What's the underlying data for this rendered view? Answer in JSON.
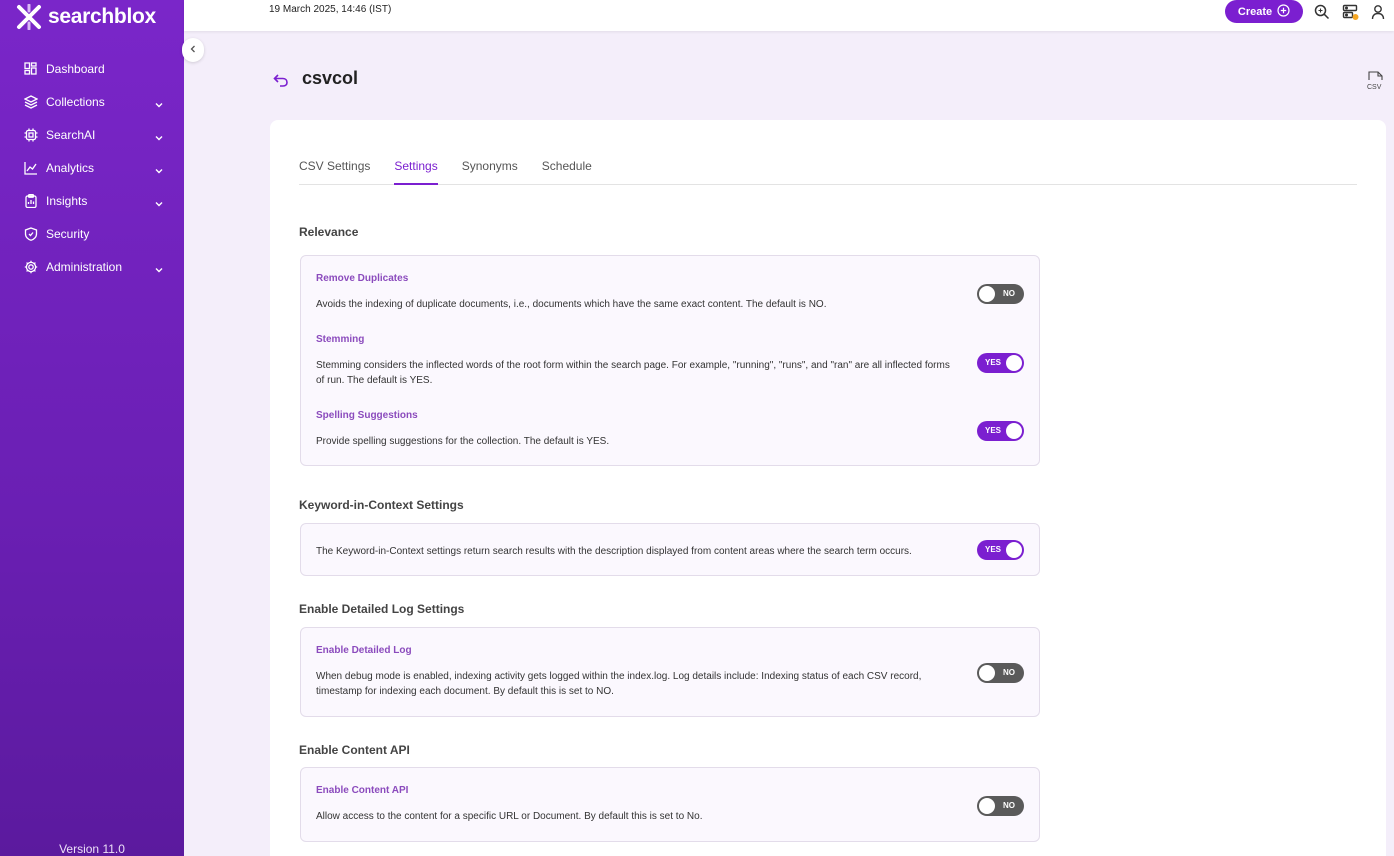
{
  "app": {
    "name": "searchblox",
    "version": "Version 11.0"
  },
  "sidebar": {
    "items": [
      {
        "label": "Dashboard",
        "icon": "dashboard-icon",
        "has_chevron": false
      },
      {
        "label": "Collections",
        "icon": "layers-icon",
        "has_chevron": true
      },
      {
        "label": "SearchAI",
        "icon": "chip-icon",
        "has_chevron": true
      },
      {
        "label": "Analytics",
        "icon": "chart-icon",
        "has_chevron": true
      },
      {
        "label": "Insights",
        "icon": "clipboard-icon",
        "has_chevron": true
      },
      {
        "label": "Security",
        "icon": "shield-icon",
        "has_chevron": false
      },
      {
        "label": "Administration",
        "icon": "gear-icon",
        "has_chevron": true
      }
    ]
  },
  "topbar": {
    "datetime": "19 March 2025, 14:46 (IST)",
    "create_label": "Create"
  },
  "page": {
    "title": "csvcol",
    "export_icon_text": "CSV"
  },
  "tabs": [
    {
      "label": "CSV Settings",
      "active": false
    },
    {
      "label": "Settings",
      "active": true
    },
    {
      "label": "Synonyms",
      "active": false
    },
    {
      "label": "Schedule",
      "active": false
    }
  ],
  "sections": {
    "relevance": {
      "title": "Relevance",
      "items": [
        {
          "title": "Remove Duplicates",
          "desc": "Avoids the indexing of duplicate documents, i.e., documents which have the same exact content. The default is NO.",
          "value": "NO"
        },
        {
          "title": "Stemming",
          "desc": "Stemming considers the inflected words of the root form within the search page. For example, \"running\", \"runs\", and \"ran\" are all inflected forms of run. The default is YES.",
          "value": "YES"
        },
        {
          "title": "Spelling Suggestions",
          "desc": "Provide spelling suggestions for the collection. The default is YES.",
          "value": "YES"
        }
      ]
    },
    "kwic": {
      "title": "Keyword-in-Context Settings",
      "desc": "The Keyword-in-Context settings return search results with the description displayed from content areas where the search term occurs.",
      "value": "YES"
    },
    "detailed_log": {
      "title": "Enable Detailed Log Settings",
      "item_title": "Enable Detailed Log",
      "desc": "When debug mode is enabled, indexing activity gets logged within the index.log. Log details include: Indexing status of each CSV record, timestamp for indexing each document. By default this is set to NO.",
      "value": "NO"
    },
    "content_api": {
      "title": "Enable Content API",
      "item_title": "Enable Content API",
      "desc": "Allow access to the content for a specific URL or Document. By default this is set to No.",
      "value": "NO"
    }
  }
}
